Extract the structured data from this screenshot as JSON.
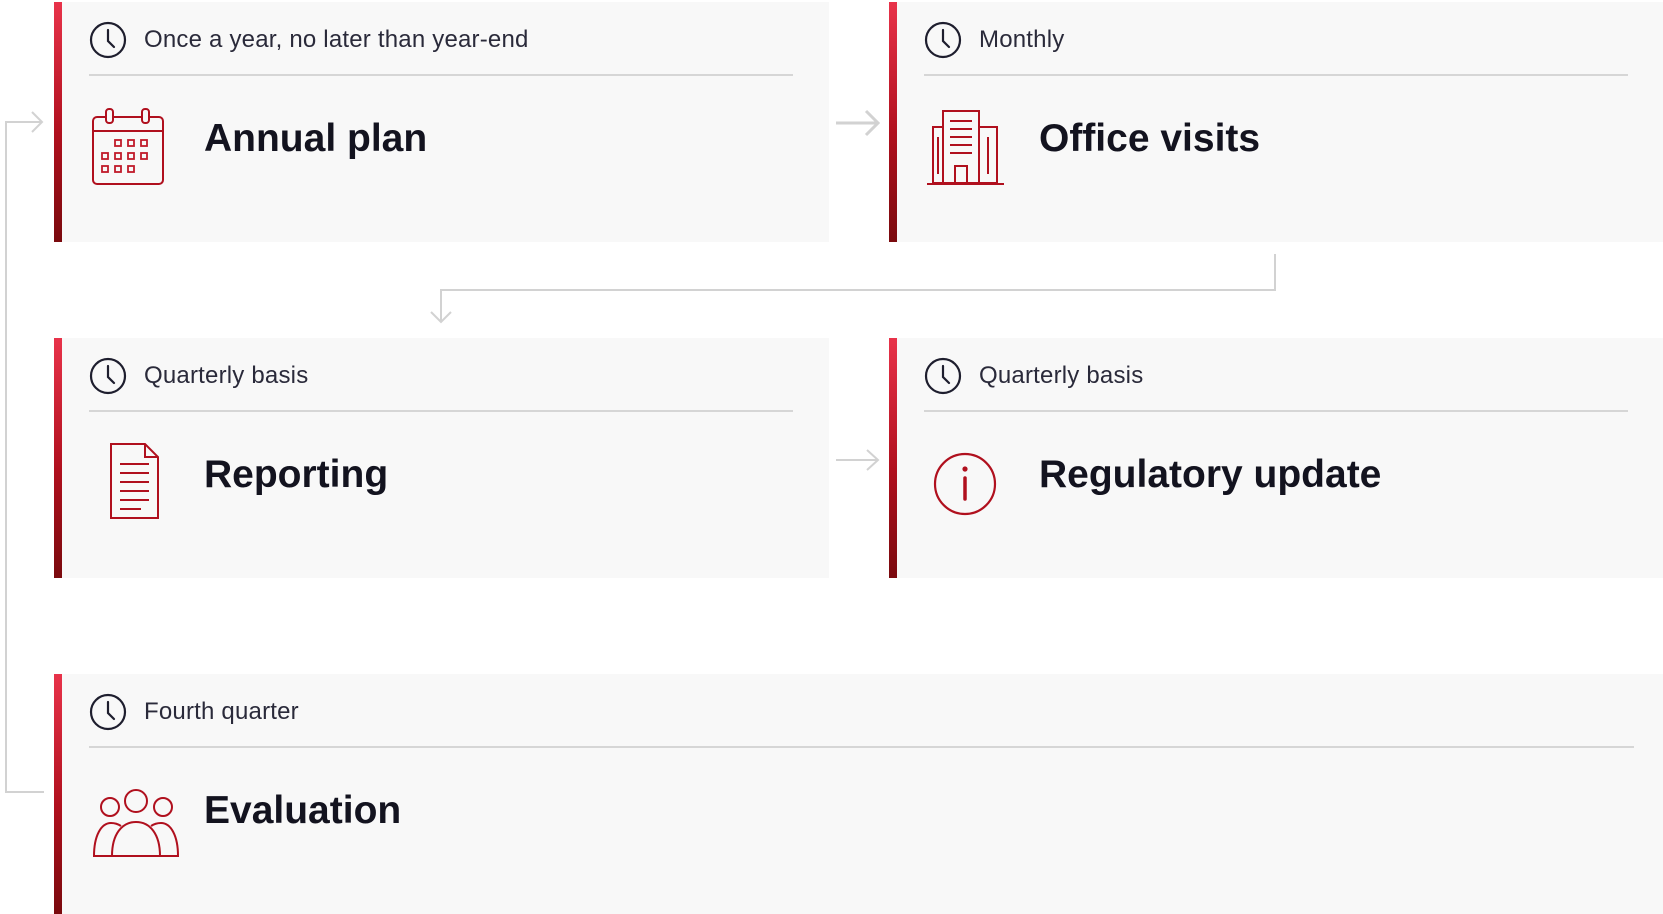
{
  "colors": {
    "accent": "#b0101e",
    "accent_light": "#e8334a",
    "connector": "#d2d2d2",
    "card_bg": "#f8f8f8"
  },
  "steps": [
    {
      "frequency": "Once a year, no later than year-end",
      "title": "Annual plan",
      "icon": "calendar-icon"
    },
    {
      "frequency": "Monthly",
      "title": "Office visits",
      "icon": "office-building-icon"
    },
    {
      "frequency": "Quarterly basis",
      "title": "Reporting",
      "icon": "document-icon"
    },
    {
      "frequency": "Quarterly basis",
      "title": "Regulatory update",
      "icon": "info-icon"
    },
    {
      "frequency": "Fourth quarter",
      "title": "Evaluation",
      "icon": "people-group-icon"
    }
  ]
}
